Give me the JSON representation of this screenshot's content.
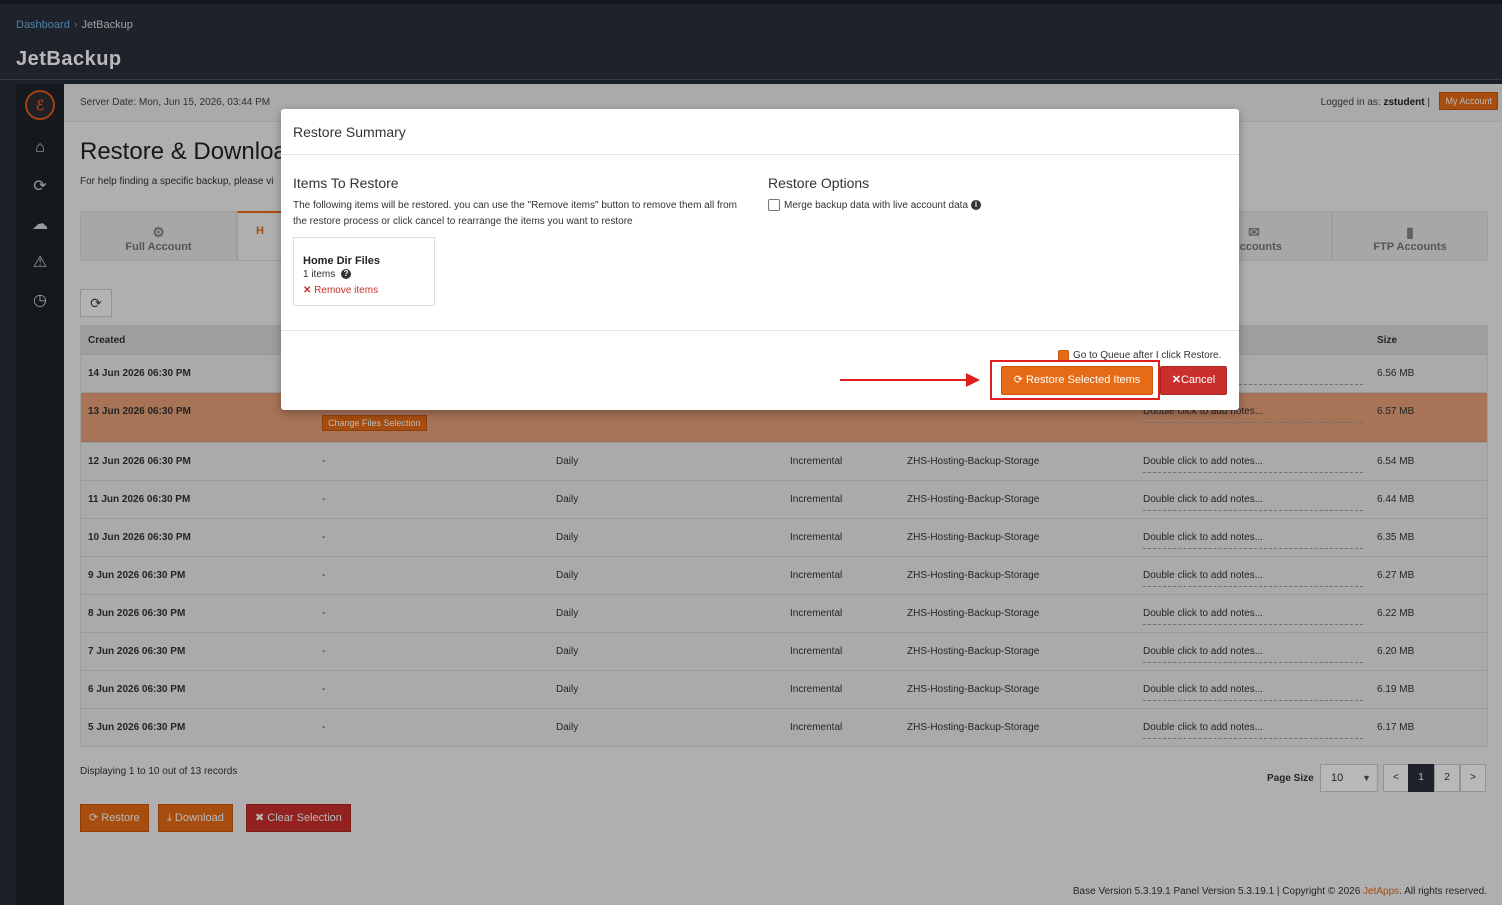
{
  "breadcrumb": {
    "home": "Dashboard",
    "separator": "›",
    "current": "JetBackup"
  },
  "app_title": "JetBackup",
  "topinfo": {
    "server_date": "Server Date: Mon, Jun 15, 2026, 03:44 PM",
    "logged_prefix": "Logged in as:",
    "user": "zstudent",
    "logged_sep": "|",
    "my_account": "My Account"
  },
  "page": {
    "title": "Restore & Downloa",
    "help": "For help finding a specific backup, please vi"
  },
  "tabs": [
    {
      "label": "Full Account",
      "icon": "cubes-icon"
    },
    {
      "label": "H",
      "icon": "home-icon"
    },
    {
      "label": "l Accounts",
      "icon": "envelope-icon"
    },
    {
      "label": "FTP Accounts",
      "icon": "file-icon"
    }
  ],
  "table": {
    "headers": {
      "created": "Created",
      "size": "Size"
    },
    "rows": [
      {
        "date": "14 Jun 2026 06:30 PM",
        "notes": "otes...",
        "size": "6.56 MB"
      },
      {
        "date": "13 Jun 2026 06:30 PM",
        "notes": "Double click to add notes...",
        "size": "6.57 MB",
        "selected": true,
        "change_btn": "Change Files Selection"
      },
      {
        "date": "12 Jun 2026 06:30 PM",
        "dash": "-",
        "schedule": "Daily",
        "type": "Incremental",
        "dest": "ZHS-Hosting-Backup-Storage",
        "notes": "Double click to add notes...",
        "size": "6.54 MB"
      },
      {
        "date": "11 Jun 2026 06:30 PM",
        "dash": "-",
        "schedule": "Daily",
        "type": "Incremental",
        "dest": "ZHS-Hosting-Backup-Storage",
        "notes": "Double click to add notes...",
        "size": "6.44 MB"
      },
      {
        "date": "10 Jun 2026 06:30 PM",
        "dash": "-",
        "schedule": "Daily",
        "type": "Incremental",
        "dest": "ZHS-Hosting-Backup-Storage",
        "notes": "Double click to add notes...",
        "size": "6.35 MB"
      },
      {
        "date": "9 Jun 2026 06:30 PM",
        "dash": "-",
        "schedule": "Daily",
        "type": "Incremental",
        "dest": "ZHS-Hosting-Backup-Storage",
        "notes": "Double click to add notes...",
        "size": "6.27 MB"
      },
      {
        "date": "8 Jun 2026 06:30 PM",
        "dash": "-",
        "schedule": "Daily",
        "type": "Incremental",
        "dest": "ZHS-Hosting-Backup-Storage",
        "notes": "Double click to add notes...",
        "size": "6.22 MB"
      },
      {
        "date": "7 Jun 2026 06:30 PM",
        "dash": "-",
        "schedule": "Daily",
        "type": "Incremental",
        "dest": "ZHS-Hosting-Backup-Storage",
        "notes": "Double click to add notes...",
        "size": "6.20 MB"
      },
      {
        "date": "6 Jun 2026 06:30 PM",
        "dash": "-",
        "schedule": "Daily",
        "type": "Incremental",
        "dest": "ZHS-Hosting-Backup-Storage",
        "notes": "Double click to add notes...",
        "size": "6.19 MB"
      },
      {
        "date": "5 Jun 2026 06:30 PM",
        "dash": "-",
        "schedule": "Daily",
        "type": "Incremental",
        "dest": "ZHS-Hosting-Backup-Storage",
        "notes": "Double click to add notes...",
        "size": "6.17 MB"
      }
    ]
  },
  "pagination": {
    "displaying": "Displaying 1 to 10 out of 13 records",
    "page_size_label": "Page Size",
    "page_size": "10",
    "prev": "<",
    "pages": [
      "1",
      "2"
    ],
    "next": ">"
  },
  "actions": {
    "restore": "Restore",
    "download": "Download",
    "clear": "Clear Selection"
  },
  "footer": {
    "text": "Base Version 5.3.19.1 Panel Version 5.3.19.1 | Copyright © 2026",
    "brand": "JetApps",
    "suffix": ". All rights reserved."
  },
  "modal": {
    "title": "Restore Summary",
    "items_heading": "Items To Restore",
    "items_desc": "The following items will be restored. you can use the \"Remove items\" button to remove them all from the restore process or click cancel to rearrange the items you want to restore",
    "item": {
      "title": "Home Dir Files",
      "count": "1 items",
      "remove": "Remove items"
    },
    "options_heading": "Restore Options",
    "merge_label": "Merge backup data with live account data",
    "merge_checked": false,
    "queue_label": "Go to Queue after I click Restore.",
    "queue_checked": true,
    "restore_btn": "Restore Selected Items",
    "cancel_btn": "Cancel"
  },
  "colors": {
    "accent": "#e66b16",
    "danger": "#c9302c",
    "highlight": "#e0201f",
    "dark": "#2b303b"
  }
}
